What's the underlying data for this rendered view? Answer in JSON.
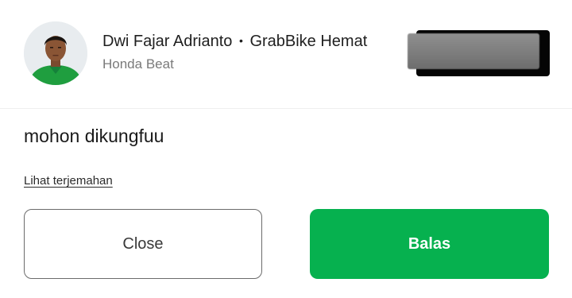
{
  "driver": {
    "name": "Dwi Fajar Adrianto",
    "separator": "•",
    "service": "GrabBike Hemat",
    "vehicle": "Honda Beat"
  },
  "message": {
    "text": "mohon dikungfuu",
    "translate_link": "Lihat terjemahan"
  },
  "actions": {
    "close_label": "Close",
    "reply_label": "Balas"
  },
  "colors": {
    "primary_green": "#06b14f",
    "avatar_shirt": "#1f9e3f",
    "close_border": "#6b6b6b",
    "redaction_gray": "#7d7d7d",
    "redaction_shadow": "#050505"
  },
  "icons": {
    "avatar": "driver-photo-avatar",
    "plate": "redacted-license-plate"
  }
}
